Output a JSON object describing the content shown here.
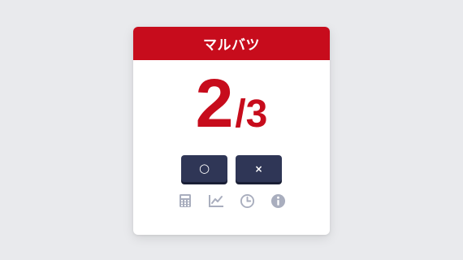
{
  "card": {
    "title": "マルバツ"
  },
  "score": {
    "current": "2",
    "separator": "/",
    "total": "3"
  },
  "buttons": {
    "circle_label": "○",
    "cross_label": "×"
  },
  "toolbar": {
    "icons": [
      "calculator-icon",
      "chart-icon",
      "clock-icon",
      "info-icon"
    ]
  },
  "colors": {
    "accent": "#c70c1c",
    "button": "#2f3656",
    "icon": "#a9aebe",
    "background": "#e9eaed"
  }
}
